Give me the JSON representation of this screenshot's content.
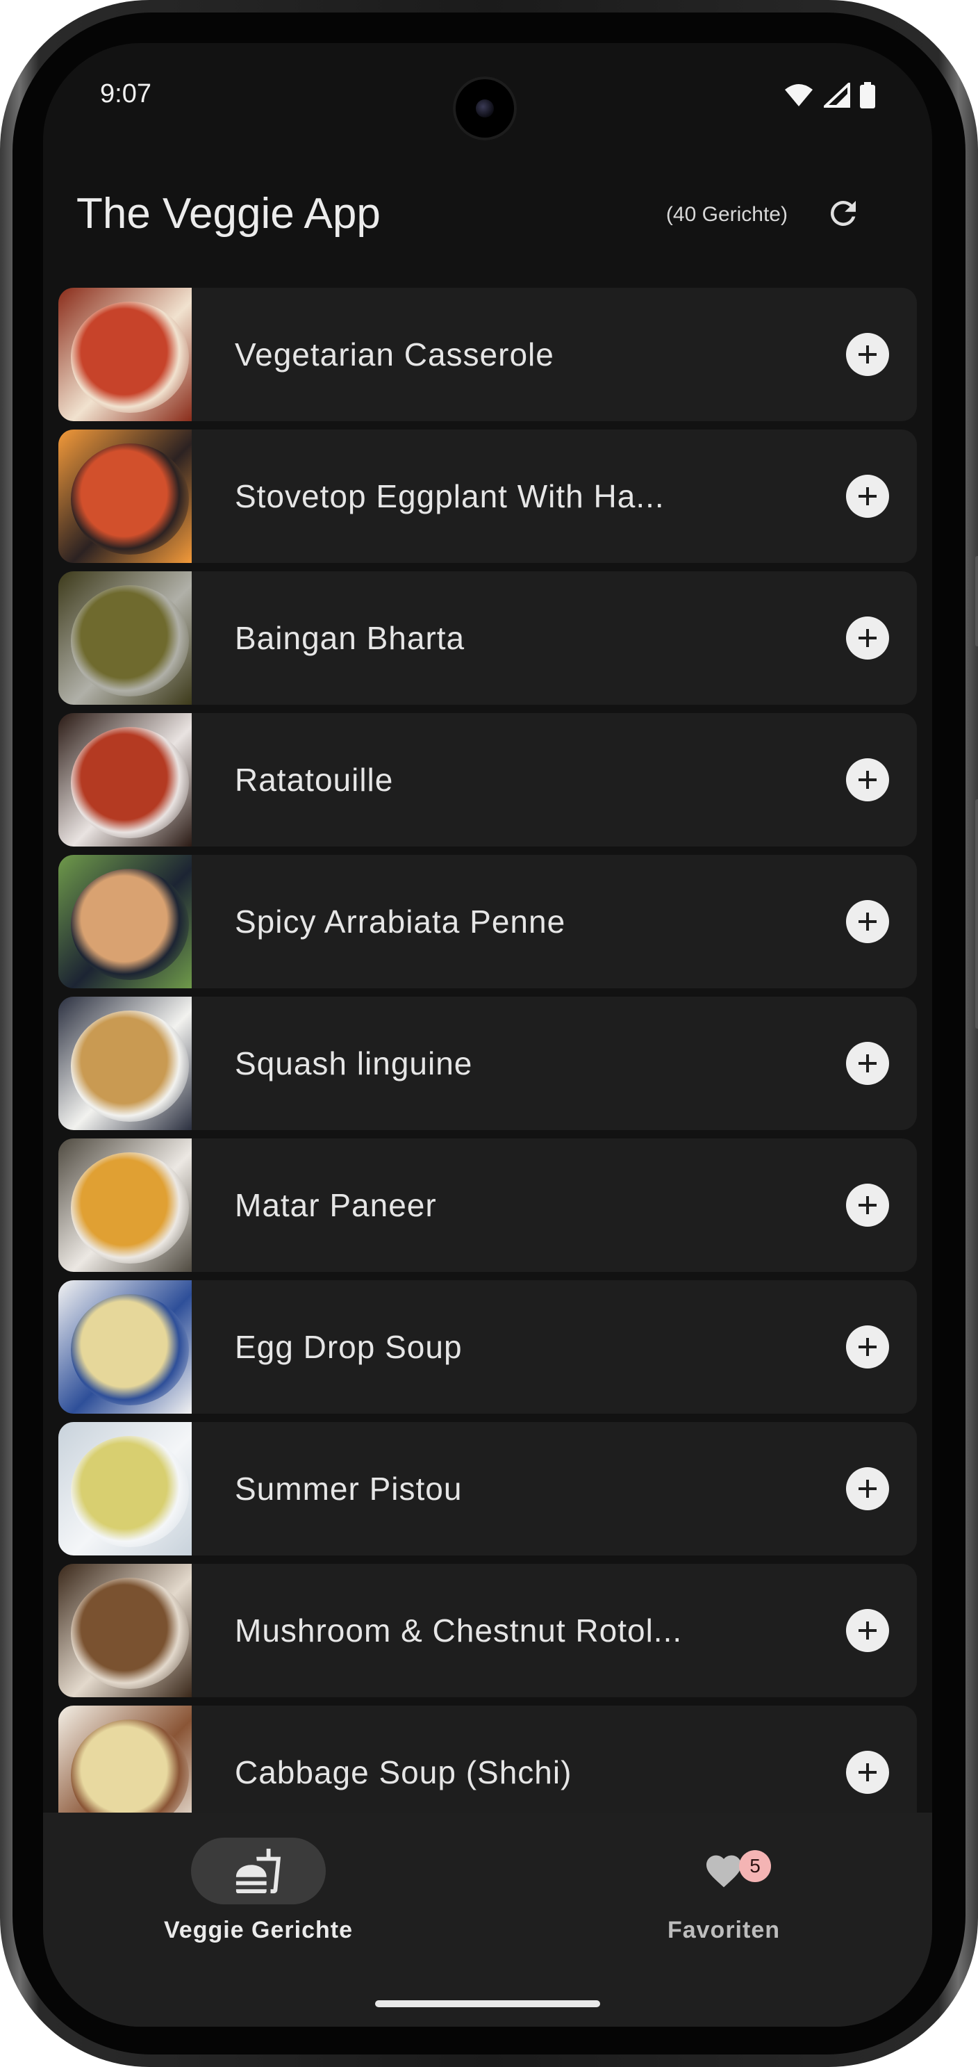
{
  "status_bar": {
    "time": "9:07",
    "icons": [
      "wifi-icon",
      "signal-icon",
      "battery-icon"
    ]
  },
  "header": {
    "title": "The Veggie App",
    "count": "(40 Gerichte)",
    "refresh_icon": "refresh-icon"
  },
  "dishes": [
    {
      "name": "Vegetarian Casserole",
      "colors": [
        "#c7432a",
        "#f1e2cf",
        "#8a2c1a"
      ]
    },
    {
      "name": "Stovetop Eggplant With Ha...",
      "colors": [
        "#d2502c",
        "#2c2222",
        "#f39a3a"
      ]
    },
    {
      "name": "Baingan Bharta",
      "colors": [
        "#6f6a2e",
        "#b0b0a8",
        "#3d3a1a"
      ]
    },
    {
      "name": "Ratatouille",
      "colors": [
        "#b43a22",
        "#e9e3e1",
        "#2a1a14"
      ]
    },
    {
      "name": "Spicy Arrabiata Penne",
      "colors": [
        "#d9a271",
        "#1c2433",
        "#6f9a4a"
      ]
    },
    {
      "name": "Squash linguine",
      "colors": [
        "#c99a52",
        "#f2f2ef",
        "#2b3040"
      ]
    },
    {
      "name": "Matar Paneer",
      "colors": [
        "#e0a033",
        "#ece8e3",
        "#4f4a40"
      ]
    },
    {
      "name": "Egg Drop Soup",
      "colors": [
        "#e6d79a",
        "#2e4f99",
        "#f2f2f2"
      ]
    },
    {
      "name": "Summer Pistou",
      "colors": [
        "#d8cf70",
        "#f4f6f8",
        "#c8d2db"
      ]
    },
    {
      "name": "Mushroom & Chestnut Rotol...",
      "colors": [
        "#7a5230",
        "#e3d9cc",
        "#3a281a"
      ]
    },
    {
      "name": "Cabbage Soup (Shchi)",
      "colors": [
        "#e8d9a0",
        "#8a5536",
        "#f3efe6"
      ]
    }
  ],
  "add_icon": "plus-circle-icon",
  "bottom_nav": {
    "items": [
      {
        "label": "Veggie Gerichte",
        "icon": "burger-drink-icon",
        "active": true
      },
      {
        "label": "Favoriten",
        "icon": "heart-icon",
        "badge": "5",
        "active": false
      }
    ]
  }
}
